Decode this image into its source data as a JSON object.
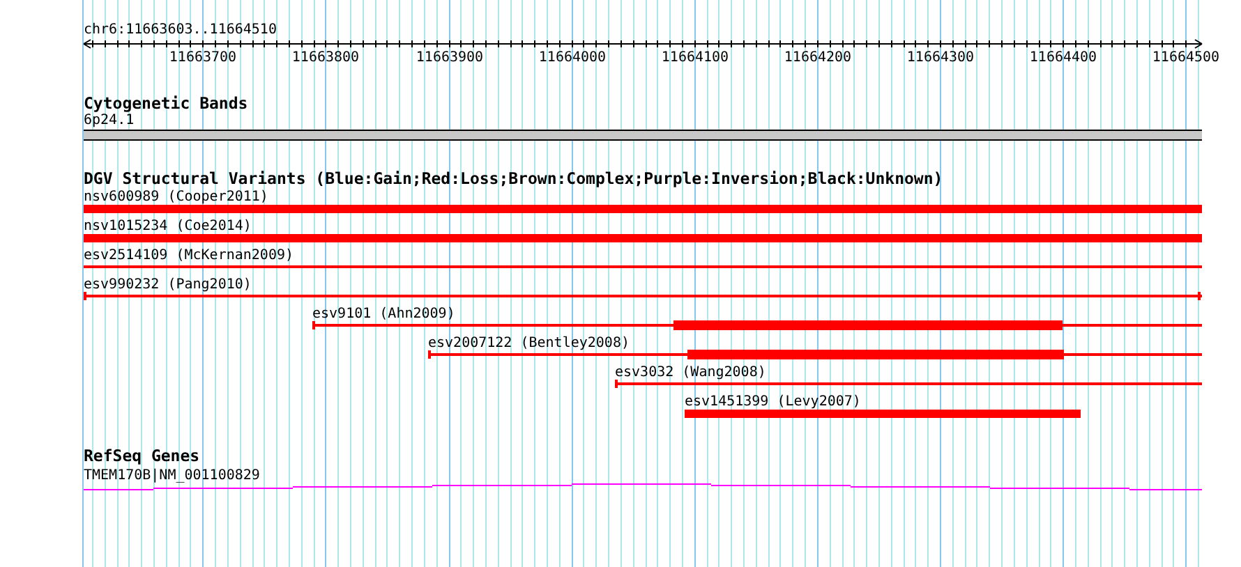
{
  "ruler": {
    "range": "chr6:11663603..11664510",
    "ticks": [
      "11663700",
      "11663800",
      "11663900",
      "11664000",
      "11664100",
      "11664200",
      "11664300",
      "11664400",
      "11664500"
    ]
  },
  "cytogenetic_bands": {
    "title": "Cytogenetic Bands",
    "band": "6p24.1"
  },
  "structural_variants": {
    "title": "DGV Structural Variants (Blue:Gain;Red:Loss;Brown:Complex;Purple:Inversion;Black:Unknown)",
    "features": [
      {
        "label": "nsv600989 (Cooper2011)",
        "kind": "solid",
        "color": "#ff0000"
      },
      {
        "label": "nsv1015234 (Coe2014)",
        "kind": "solid",
        "color": "#ff0000"
      },
      {
        "label": "esv2514109 (McKernan2009)",
        "kind": "line",
        "color": "#ff0000"
      },
      {
        "label": "esv990232 (Pang2010)",
        "kind": "line",
        "color": "#ff0000"
      },
      {
        "label": "esv9101 (Ahn2009)",
        "kind": "line-with-core",
        "color": "#ff0000"
      },
      {
        "label": "esv2007122 (Bentley2008)",
        "kind": "line-with-core",
        "color": "#ff0000"
      },
      {
        "label": "esv3032 (Wang2008)",
        "kind": "line",
        "color": "#ff0000"
      },
      {
        "label": "esv1451399 (Levy2007)",
        "kind": "solid",
        "color": "#ff0000"
      }
    ]
  },
  "refseq_genes": {
    "title": "RefSeq Genes",
    "gene": "TMEM170B|NM_001100829"
  }
}
